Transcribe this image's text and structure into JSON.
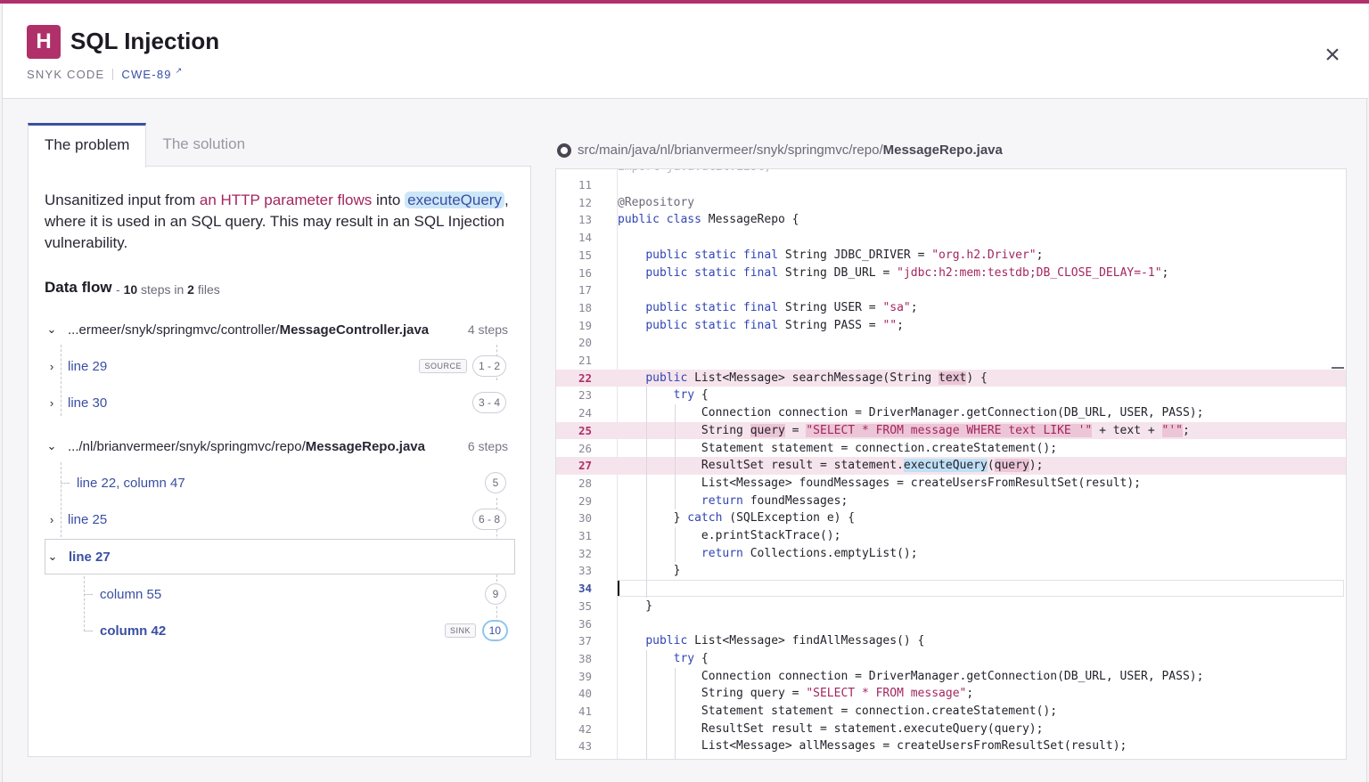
{
  "header": {
    "severity": "H",
    "title": "SQL Injection",
    "source": "SNYK CODE",
    "cwe": "CWE-89",
    "close_icon": "close-icon"
  },
  "tabs": [
    {
      "label": "The problem",
      "active": true
    },
    {
      "label": "The solution",
      "active": false
    }
  ],
  "problem": {
    "desc_pre": "Unsanitized input from ",
    "desc_flow": "an HTTP parameter flows",
    "desc_into": " into ",
    "desc_func": "executeQuery",
    "desc_post": ", where it is used in an SQL query. This may result in an SQL Injection vulnerability."
  },
  "dataflow": {
    "title": "Data flow",
    "dash": "-",
    "steps_count": "10",
    "steps_word": "steps in",
    "files_count": "2",
    "files_word": "files",
    "files": [
      {
        "path_prefix": "...ermeer/snyk/springmvc/controller/",
        "filename": "MessageController.java",
        "steps": "4 steps",
        "items": [
          {
            "label": "line 29",
            "tag": "SOURCE",
            "pill": "1 - 2"
          },
          {
            "label": "line 30",
            "pill": "3 - 4"
          }
        ]
      },
      {
        "path_prefix": ".../nl/brianvermeer/snyk/springmvc/repo/",
        "filename": "MessageRepo.java",
        "steps": "6 steps",
        "items": [
          {
            "label": "line 22, column 47",
            "pill": "5"
          },
          {
            "label": "line 25",
            "pill": "6 - 8"
          },
          {
            "label": "line 27",
            "children": [
              {
                "label": "column 55",
                "pill": "9"
              },
              {
                "label": "column 42",
                "tag": "SINK",
                "pill": "10"
              }
            ]
          }
        ]
      }
    ]
  },
  "code": {
    "path_prefix": "src/main/java/nl/brianvermeer/snyk/springmvc/repo/",
    "filename": "MessageRepo.java",
    "first_line_partial": "import java.util.List;",
    "lines": [
      {
        "n": "11",
        "code": ""
      },
      {
        "n": "12",
        "code": "@Repository"
      },
      {
        "n": "13",
        "code": "public class MessageRepo {"
      },
      {
        "n": "14",
        "code": ""
      },
      {
        "n": "15",
        "code": "    public static final String JDBC_DRIVER = \"org.h2.Driver\";"
      },
      {
        "n": "16",
        "code": "    public static final String DB_URL = \"jdbc:h2:mem:testdb;DB_CLOSE_DELAY=-1\";"
      },
      {
        "n": "17",
        "code": ""
      },
      {
        "n": "18",
        "code": "    public static final String USER = \"sa\";"
      },
      {
        "n": "19",
        "code": "    public static final String PASS = \"\";"
      },
      {
        "n": "20",
        "code": ""
      },
      {
        "n": "21",
        "code": ""
      },
      {
        "n": "22",
        "code": "    public List<Message> searchMessage(String text) {"
      },
      {
        "n": "23",
        "code": "        try {"
      },
      {
        "n": "24",
        "code": "            Connection connection = DriverManager.getConnection(DB_URL, USER, PASS);"
      },
      {
        "n": "25",
        "code": "            String query = \"SELECT * FROM message WHERE text LIKE '\" + text + \"'\";"
      },
      {
        "n": "26",
        "code": "            Statement statement = connection.createStatement();"
      },
      {
        "n": "27",
        "code": "            ResultSet result = statement.executeQuery(query);"
      },
      {
        "n": "28",
        "code": "            List<Message> foundMessages = createUsersFromResultSet(result);"
      },
      {
        "n": "29",
        "code": "            return foundMessages;"
      },
      {
        "n": "30",
        "code": "        } catch (SQLException e) {"
      },
      {
        "n": "31",
        "code": "            e.printStackTrace();"
      },
      {
        "n": "32",
        "code": "            return Collections.emptyList();"
      },
      {
        "n": "33",
        "code": "        }"
      },
      {
        "n": "34",
        "code": ""
      },
      {
        "n": "35",
        "code": "    }"
      },
      {
        "n": "36",
        "code": ""
      },
      {
        "n": "37",
        "code": "    public List<Message> findAllMessages() {"
      },
      {
        "n": "38",
        "code": "        try {"
      },
      {
        "n": "39",
        "code": "            Connection connection = DriverManager.getConnection(DB_URL, USER, PASS);"
      },
      {
        "n": "40",
        "code": "            String query = \"SELECT * FROM message\";"
      },
      {
        "n": "41",
        "code": "            Statement statement = connection.createStatement();"
      },
      {
        "n": "42",
        "code": "            ResultSet result = statement.executeQuery(query);"
      },
      {
        "n": "43",
        "code": "            List<Message> allMessages = createUsersFromResultSet(result);"
      }
    ],
    "marked_lines": [
      "22",
      "25",
      "27"
    ],
    "current_line": "34"
  },
  "colors": {
    "accent": "#b0306a",
    "link": "#3a4fa3",
    "highlight_blue": "#bfe0f6",
    "highlight_red": "#ecc6d6"
  }
}
